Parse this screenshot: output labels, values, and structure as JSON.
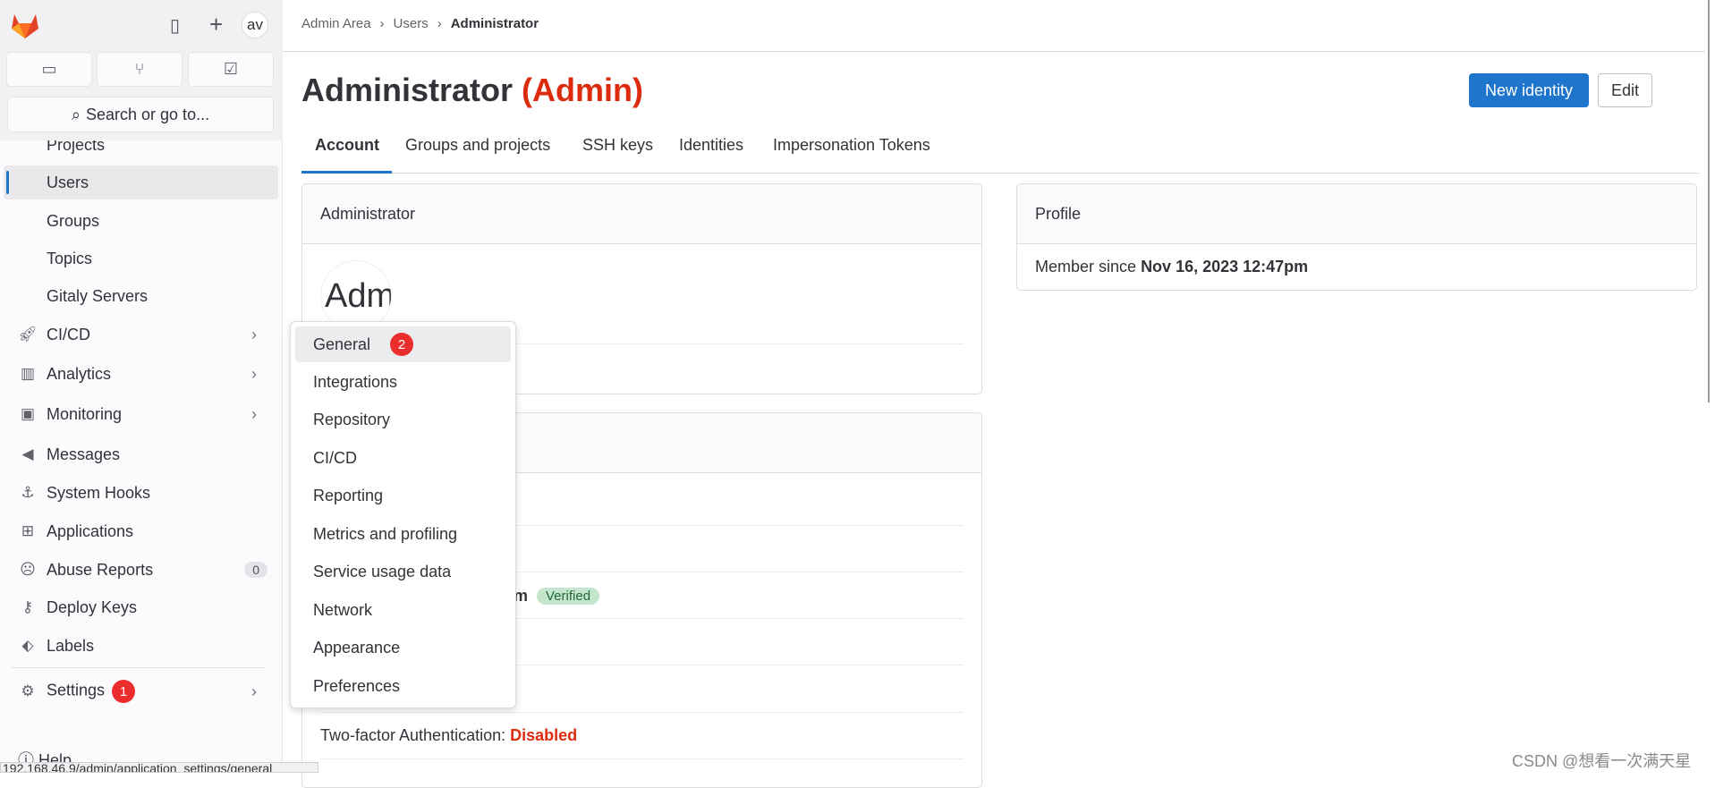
{
  "sidebar": {
    "avatar": "av",
    "search_placeholder": "Search or go to...",
    "items": [
      {
        "label": "Projects",
        "icon": "project-icon"
      },
      {
        "label": "Users",
        "icon": "user-icon",
        "active": true
      },
      {
        "label": "Groups",
        "icon": "group-icon"
      },
      {
        "label": "Topics",
        "icon": "topic-icon"
      },
      {
        "label": "Gitaly Servers",
        "icon": "server-icon"
      },
      {
        "label": "CI/CD",
        "icon": "rocket-icon"
      },
      {
        "label": "Analytics",
        "icon": "chart-icon"
      },
      {
        "label": "Monitoring",
        "icon": "monitor-icon"
      },
      {
        "label": "Messages",
        "icon": "megaphone-icon"
      },
      {
        "label": "System Hooks",
        "icon": "anchor-icon"
      },
      {
        "label": "Applications",
        "icon": "apps-icon"
      },
      {
        "label": "Abuse Reports",
        "icon": "abuse-icon",
        "count": "0"
      },
      {
        "label": "Deploy Keys",
        "icon": "key-icon"
      },
      {
        "label": "Labels",
        "icon": "label-icon"
      }
    ],
    "settings": {
      "label": "Settings",
      "annotation": "1"
    },
    "help": "Help"
  },
  "breadcrumb": [
    "Admin Area",
    "Users",
    "Administrator"
  ],
  "header": {
    "name": "Administrator",
    "role": "(Admin)",
    "new_identity": "New identity",
    "edit": "Edit"
  },
  "tabs": [
    "Account",
    "Groups and projects",
    "SSH keys",
    "Identities",
    "Impersonation Tokens"
  ],
  "account_card": {
    "title": "Administrator",
    "avatar_text": "Adm"
  },
  "second_card": {
    "email_fragment": "om",
    "verified": "Verified",
    "two_factor_label": "Two-factor Authentication:",
    "two_factor_value": "Disabled"
  },
  "profile_card": {
    "title": "Profile",
    "member_since_label": "Member since",
    "member_since_value": "Nov 16, 2023 12:47pm"
  },
  "settings_menu": {
    "items": [
      "General",
      "Integrations",
      "Repository",
      "CI/CD",
      "Reporting",
      "Metrics and profiling",
      "Service usage data",
      "Network",
      "Appearance",
      "Preferences"
    ],
    "annotation": "2"
  },
  "status_url": "192.168.46.9/admin/application_settings/general",
  "watermark": "CSDN @想看一次满天星",
  "colors": {
    "accent": "#1f75cb",
    "danger": "#dd2b0e",
    "badge": "#ec2d2d",
    "verified_bg": "#c3e6cd"
  }
}
